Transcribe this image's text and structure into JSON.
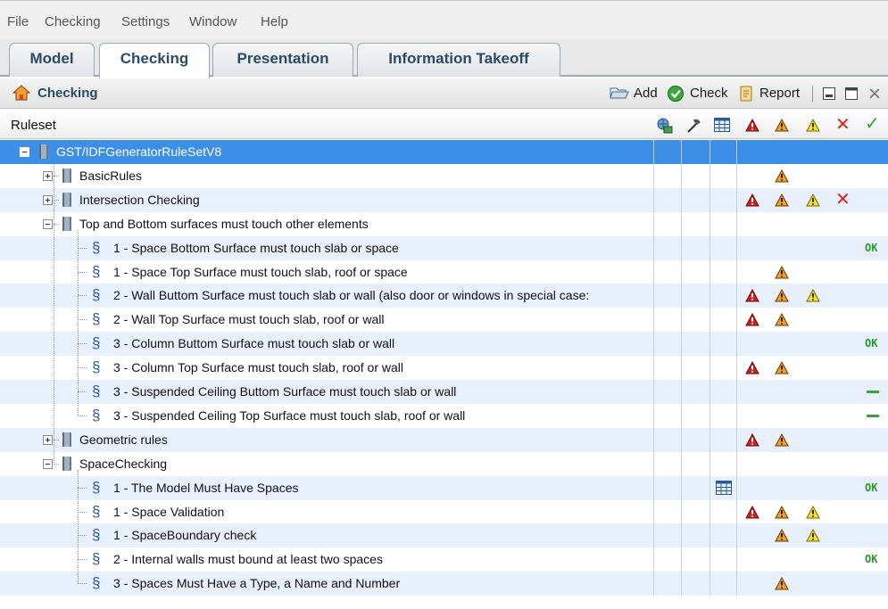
{
  "menu": [
    "File",
    "Checking",
    "Settings",
    "Window",
    "Help"
  ],
  "tabs": [
    "Model",
    "Checking",
    "Presentation",
    "Information Takeoff"
  ],
  "panel": {
    "title": "Checking",
    "add_label": "Add",
    "check_label": "Check",
    "report_label": "Report"
  },
  "column_header": {
    "ruleset_label": "Ruleset",
    "column_icons": [
      "model-icon",
      "hammer-icon",
      "table-icon",
      "critical-warning-icon",
      "moderate-warning-icon",
      "low-warning-icon",
      "rejected-icon",
      "accepted-icon"
    ]
  },
  "colors": {
    "selection": "#3d8ee6",
    "alt_row": "#e8f0fb",
    "critical": "#cc2222",
    "moderate": "#f0a020",
    "low": "#f4e030",
    "ok": "#2a9a2a"
  },
  "tree": [
    {
      "level": 0,
      "type": "ruleset",
      "expanded": true,
      "label": "GST/IDFGeneratorRuleSetV8",
      "selected": true,
      "status": []
    },
    {
      "level": 1,
      "type": "folder",
      "expanded": false,
      "label": "BasicRules",
      "status": [
        "moderate"
      ]
    },
    {
      "level": 1,
      "type": "folder",
      "expanded": false,
      "label": "Intersection Checking",
      "status": [
        "critical",
        "moderate",
        "low",
        "rejected"
      ]
    },
    {
      "level": 1,
      "type": "folder",
      "expanded": true,
      "label": "Top and Bottom surfaces must touch other elements",
      "status": []
    },
    {
      "level": 2,
      "type": "rule",
      "label": "1 - Space Bottom Surface must touch slab or space",
      "status": [
        "ok"
      ]
    },
    {
      "level": 2,
      "type": "rule",
      "label": "1 - Space Top Surface must touch slab, roof or space",
      "status": [
        "moderate"
      ]
    },
    {
      "level": 2,
      "type": "rule",
      "label": "2 - Wall Buttom Surface must touch slab or wall (also door or windows in special case:",
      "status": [
        "critical",
        "moderate",
        "low"
      ]
    },
    {
      "level": 2,
      "type": "rule",
      "label": "2 - Wall Top Surface must touch slab, roof or wall",
      "status": [
        "critical",
        "moderate"
      ]
    },
    {
      "level": 2,
      "type": "rule",
      "label": "3 - Column Buttom Surface must touch slab or wall",
      "status": [
        "ok"
      ]
    },
    {
      "level": 2,
      "type": "rule",
      "label": "3 - Column Top Surface must touch slab, roof or wall",
      "status": [
        "critical",
        "moderate"
      ]
    },
    {
      "level": 2,
      "type": "rule",
      "label": "3 - Suspended Ceiling  Buttom Surface must touch slab or wall",
      "status": [
        "dash"
      ]
    },
    {
      "level": 2,
      "type": "rule",
      "label": "3 - Suspended Ceiling Top Surface must touch slab, roof or wall",
      "status": [
        "dash"
      ]
    },
    {
      "level": 1,
      "type": "folder",
      "expanded": false,
      "label": "Geometric rules",
      "status": [
        "critical",
        "moderate"
      ]
    },
    {
      "level": 1,
      "type": "folder",
      "expanded": true,
      "label": "SpaceChecking",
      "status": []
    },
    {
      "level": 2,
      "type": "rule",
      "label": "1 - The Model Must Have Spaces",
      "status": [
        "table",
        "ok"
      ]
    },
    {
      "level": 2,
      "type": "rule",
      "label": "1 - Space Validation",
      "status": [
        "critical",
        "moderate",
        "low"
      ]
    },
    {
      "level": 2,
      "type": "rule",
      "label": "1 - SpaceBoundary check",
      "status": [
        "moderate",
        "low"
      ]
    },
    {
      "level": 2,
      "type": "rule",
      "label": "2 - Internal walls must bound at least two spaces",
      "status": [
        "ok"
      ]
    },
    {
      "level": 2,
      "type": "rule",
      "label": "3 - Spaces Must Have a Type, a Name and Number",
      "status": [
        "moderate"
      ]
    }
  ],
  "ok_text": "OK",
  "paragraph_glyph": "§"
}
